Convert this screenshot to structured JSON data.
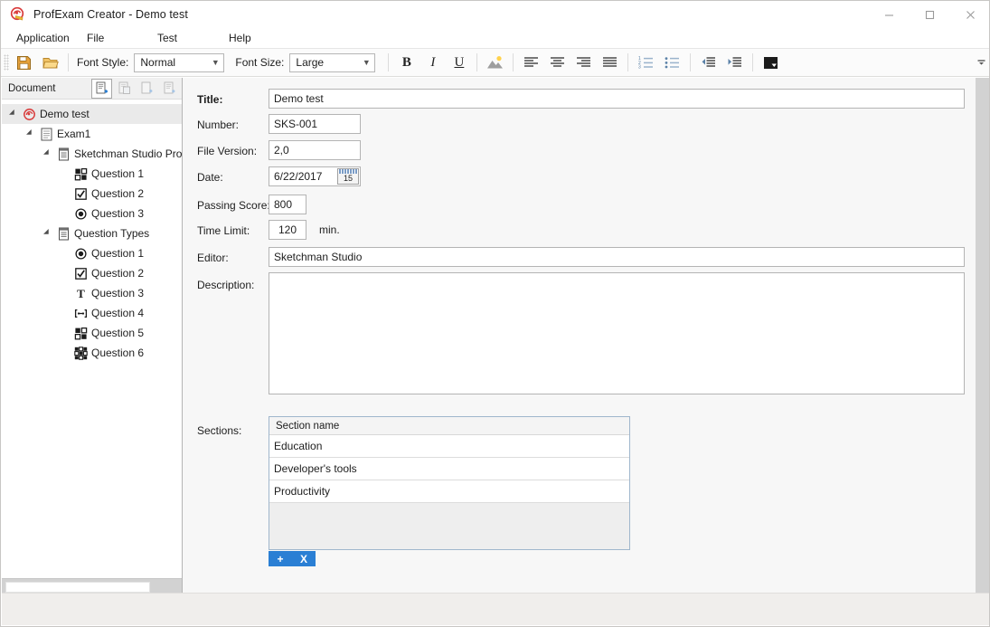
{
  "window": {
    "title": "ProfExam Creator - Demo test",
    "app_icon": "profexam-logo-icon",
    "minimize": "–",
    "maximize": "⬜",
    "close": "✕"
  },
  "menubar": {
    "items": [
      {
        "label": "Application"
      },
      {
        "label": "File"
      },
      {
        "label": "Test"
      },
      {
        "label": "Help"
      }
    ]
  },
  "toolbar": {
    "save_icon": "floppy-disk-save-icon",
    "open_icon": "open-folder-icon",
    "font_style_label": "Font Style:",
    "font_style_value": "Normal",
    "font_size_label": "Font Size:",
    "font_size_value": "Large",
    "bold": "B",
    "italic": "I",
    "underline": "U",
    "image_icon": "insert-image-icon",
    "align_left_icon": "align-left-icon",
    "align_center_icon": "align-center-icon",
    "align_right_icon": "align-right-icon",
    "align_justify_icon": "align-justify-icon",
    "numbered_list_icon": "numbered-list-icon",
    "bulleted_list_icon": "bulleted-list-icon",
    "outdent_icon": "decrease-indent-icon",
    "indent_icon": "increase-indent-icon",
    "color_icon": "text-color-icon",
    "overflow_chevron": "▾"
  },
  "document_panel": {
    "header_title": "Document",
    "buttons": [
      {
        "name": "add-document-icon",
        "enabled": true
      },
      {
        "name": "copy-document-icon",
        "enabled": false
      },
      {
        "name": "paste-document-icon",
        "enabled": false
      },
      {
        "name": "edit-document-icon",
        "enabled": false
      }
    ],
    "tree": [
      {
        "label": "Demo test",
        "depth": 0,
        "icon": "test-root-icon",
        "expandable": true,
        "selected": true
      },
      {
        "label": "Exam1",
        "depth": 1,
        "icon": "exam-icon",
        "expandable": true,
        "selected": false
      },
      {
        "label": "Sketchman Studio Pro",
        "depth": 2,
        "icon": "section-icon",
        "expandable": true,
        "selected": false
      },
      {
        "label": "Question 1",
        "depth": 3,
        "icon": "multi-choice-icon",
        "expandable": false,
        "selected": false
      },
      {
        "label": "Question 2",
        "depth": 3,
        "icon": "checkbox-icon",
        "expandable": false,
        "selected": false
      },
      {
        "label": "Question 3",
        "depth": 3,
        "icon": "radio-icon",
        "expandable": false,
        "selected": false
      },
      {
        "label": "Question Types",
        "depth": 2,
        "icon": "section-icon",
        "expandable": true,
        "selected": false
      },
      {
        "label": "Question 1",
        "depth": 3,
        "icon": "radio-icon",
        "expandable": false,
        "selected": false
      },
      {
        "label": "Question 2",
        "depth": 3,
        "icon": "checkbox-icon",
        "expandable": false,
        "selected": false
      },
      {
        "label": "Question 3",
        "depth": 3,
        "icon": "text-input-icon",
        "expandable": false,
        "selected": false
      },
      {
        "label": "Question 4",
        "depth": 3,
        "icon": "range-icon",
        "expandable": false,
        "selected": false
      },
      {
        "label": "Question 5",
        "depth": 3,
        "icon": "multi-choice-icon",
        "expandable": false,
        "selected": false
      },
      {
        "label": "Question 6",
        "depth": 3,
        "icon": "matrix-icon",
        "expandable": false,
        "selected": false
      }
    ]
  },
  "form": {
    "title_label": "Title:",
    "title_value": "Demo test",
    "number_label": "Number:",
    "number_value": "SKS-001",
    "file_version_label": "File Version:",
    "file_version_value": "2,0",
    "date_label": "Date:",
    "date_value": "6/22/2017",
    "date_button_icon": "calendar-picker-icon",
    "date_button_day": "15",
    "passing_score_label": "Passing Score:",
    "passing_score_value": "800",
    "time_limit_label": "Time Limit:",
    "time_limit_value": "120",
    "time_limit_suffix": "min.",
    "editor_label": "Editor:",
    "editor_value": "Sketchman Studio",
    "description_label": "Description:",
    "description_value": "",
    "sections_label": "Sections:"
  },
  "sections_grid": {
    "columns": [
      "Section name"
    ],
    "rows": [
      [
        "Education"
      ],
      [
        "Developer's tools"
      ],
      [
        "Productivity"
      ]
    ],
    "add_button": "+",
    "remove_button": "X"
  },
  "colors": {
    "accent_blue": "#2a7fd4",
    "grid_border": "#9fb6cc",
    "selection_gray": "#eaeaea",
    "panel_bg": "#f7f7f7",
    "status_bg": "#f0eeec"
  }
}
